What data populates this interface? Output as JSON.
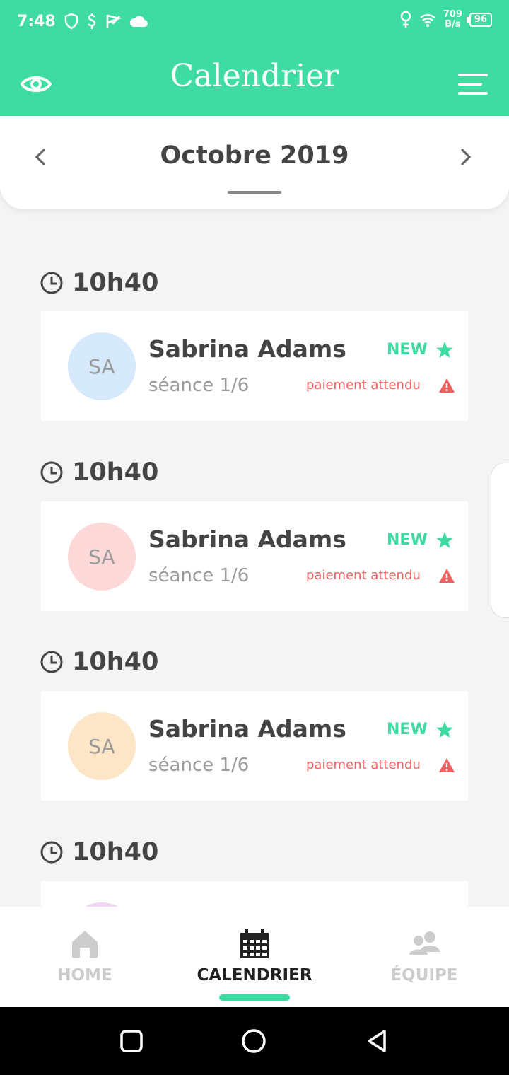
{
  "status_bar": {
    "time": "7:48",
    "speed_value": "709",
    "speed_unit": "B/s",
    "battery": "96",
    "icons": [
      "shield-icon",
      "dollar-icon",
      "flag-icon",
      "cloud-icon",
      "location-icon",
      "wifi-icon"
    ]
  },
  "app_bar": {
    "title": "Calendrier",
    "left_icon": "eye-icon",
    "right_icon": "menu-icon"
  },
  "month_selector": {
    "label": "Octobre 2019",
    "prev_icon": "chevron-left-icon",
    "next_icon": "chevron-right-icon"
  },
  "appointments": [
    {
      "time": "10h40",
      "initials": "SA",
      "avatar_color": "#d6e9fb",
      "name": "Sabrina Adams",
      "session": "séance 1/6",
      "badge": "NEW",
      "payment_status": "paiement attendu"
    },
    {
      "time": "10h40",
      "initials": "SA",
      "avatar_color": "#fcd8d8",
      "name": "Sabrina Adams",
      "session": "séance 1/6",
      "badge": "NEW",
      "payment_status": "paiement attendu"
    },
    {
      "time": "10h40",
      "initials": "SA",
      "avatar_color": "#fde6c8",
      "name": "Sabrina Adams",
      "session": "séance 1/6",
      "badge": "NEW",
      "payment_status": "paiement attendu"
    },
    {
      "time": "10h40",
      "initials": "",
      "avatar_color": "#efd6f1",
      "name": "",
      "session": "",
      "badge": "",
      "payment_status": ""
    }
  ],
  "bottom_nav": {
    "items": [
      {
        "label": "HOME",
        "icon": "home-icon",
        "active": false
      },
      {
        "label": "CALENDRIER",
        "icon": "calendar-icon",
        "active": true
      },
      {
        "label": "ÉQUIPE",
        "icon": "team-icon",
        "active": false
      }
    ]
  },
  "colors": {
    "accent": "#3fdca1",
    "warning": "#f06060",
    "text_dark": "#444444",
    "text_muted": "#9a9a9a",
    "nav_inactive": "#cccccc"
  }
}
